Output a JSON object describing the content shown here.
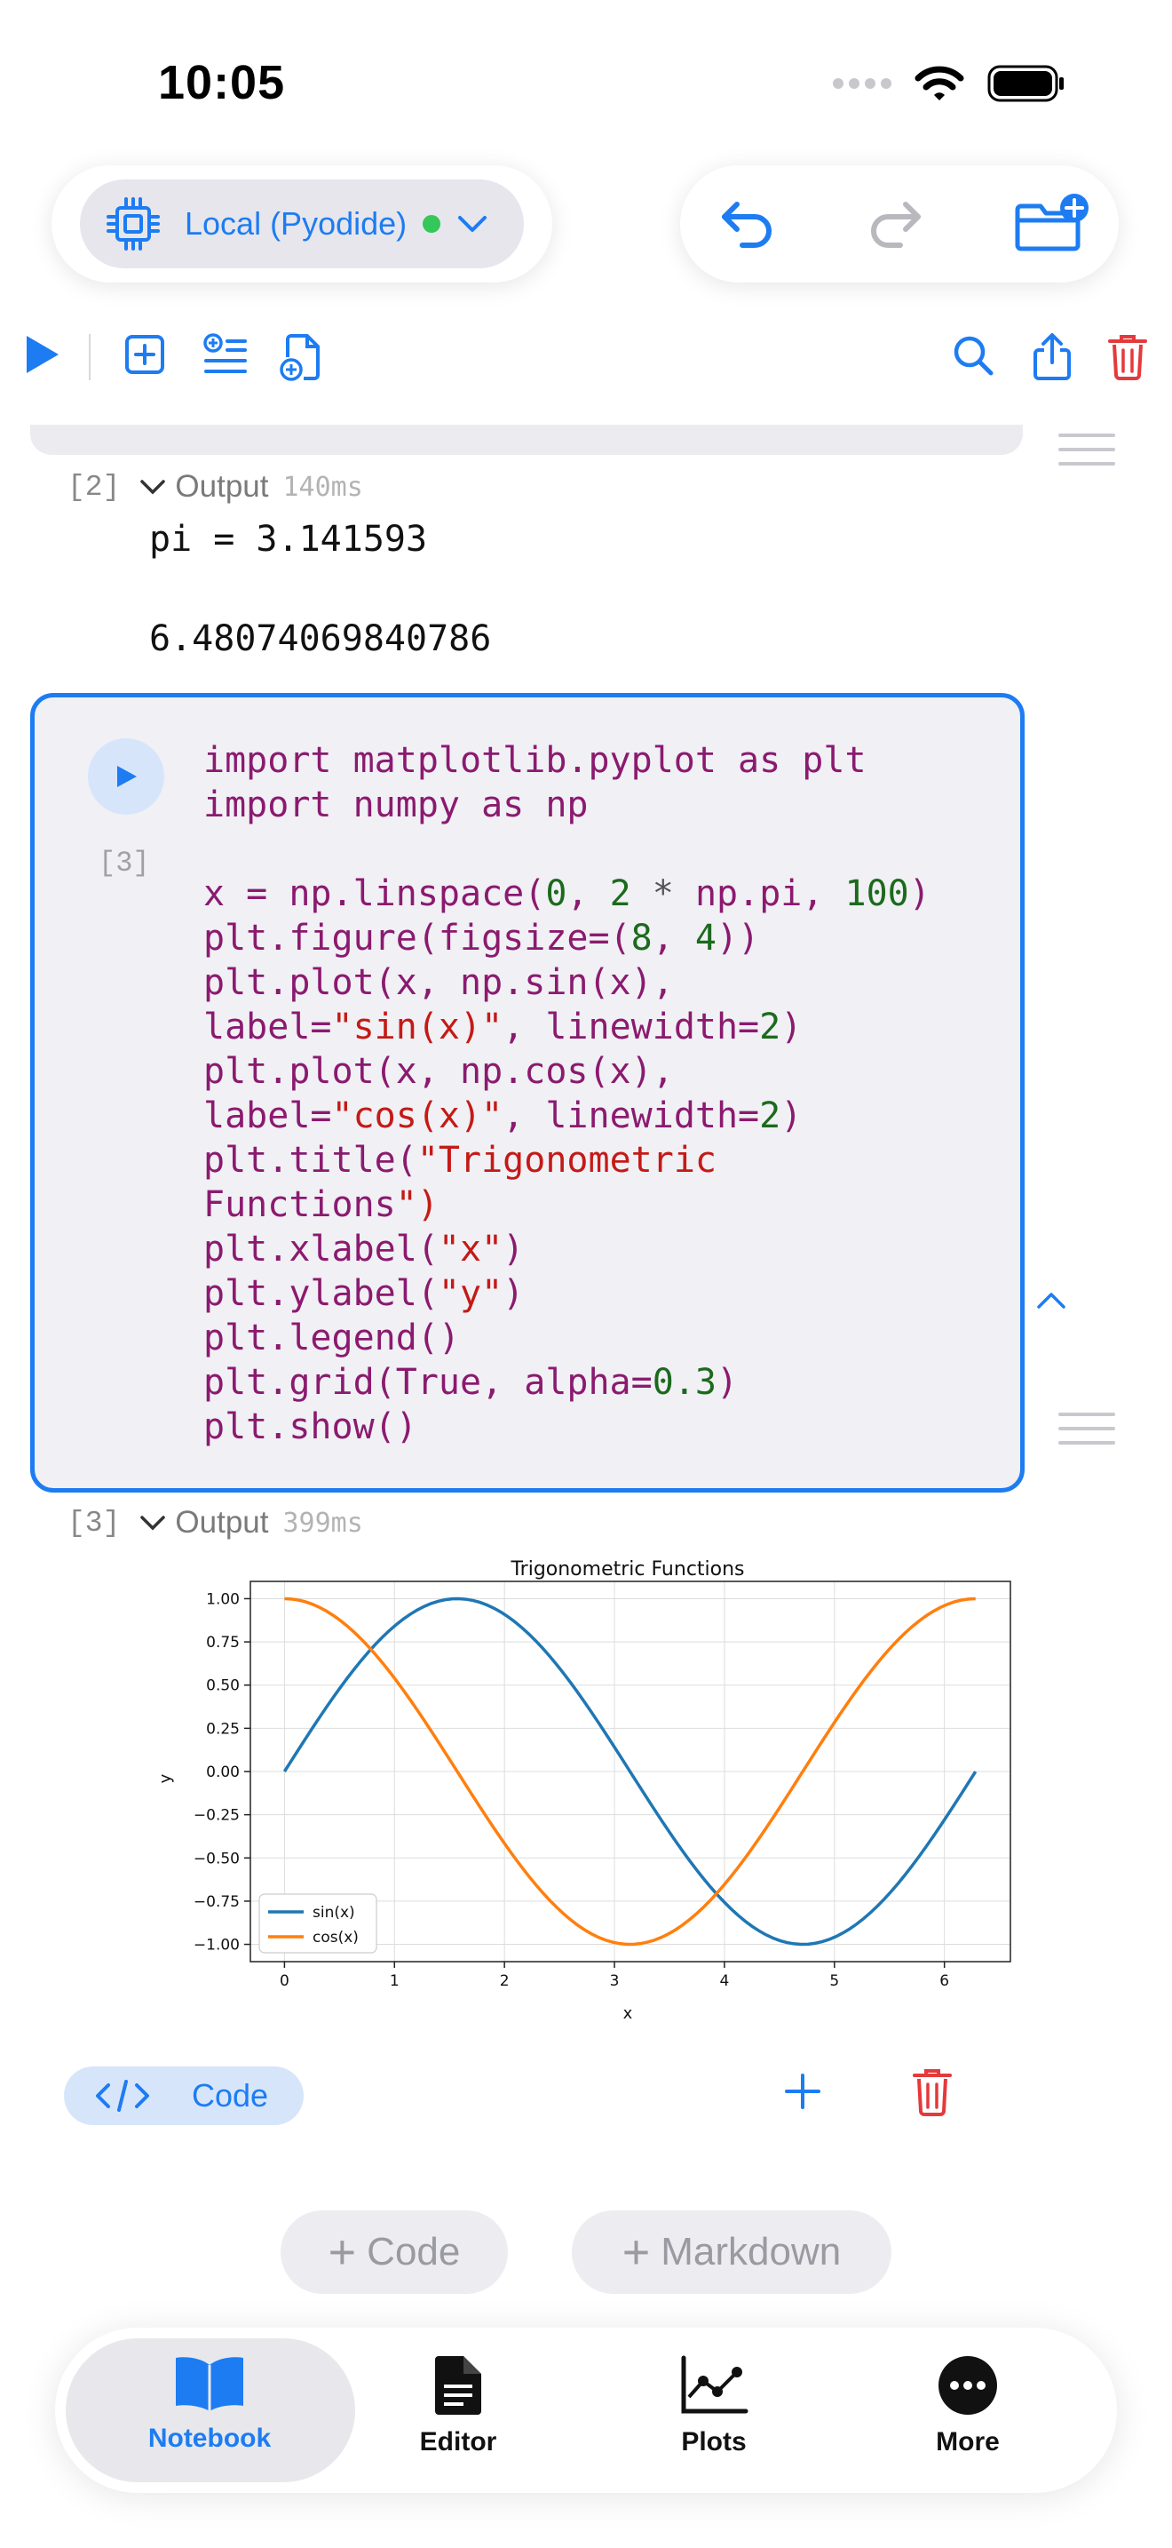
{
  "status_bar": {
    "time": "10:05"
  },
  "header": {
    "runtime_label": "Local (Pyodide)",
    "runtime_status_color": "#34c759",
    "icons": [
      "cpu-icon",
      "undo-icon",
      "redo-icon",
      "folder-add-icon"
    ]
  },
  "toolbar": {
    "left_icons": [
      "run-all-icon",
      "add-cell-icon",
      "insert-list-icon",
      "new-document-icon"
    ],
    "right_icons": [
      "search-icon",
      "share-icon",
      "trash-icon"
    ]
  },
  "output_2": {
    "number": "[2]",
    "label": "Output",
    "time": "140ms",
    "line1": "pi = 3.141593",
    "line2": "6.48074069840786"
  },
  "cell_3": {
    "number": "[3]",
    "code_lines": [
      "import matplotlib.pyplot as plt",
      "import numpy as np",
      "",
      "x = np.linspace(0, 2 * np.pi, 100)",
      "plt.figure(figsize=(8, 4))",
      "plt.plot(x, np.sin(x),",
      "label=\"sin(x)\", linewidth=2)",
      "plt.plot(x, np.cos(x),",
      "label=\"cos(x)\", linewidth=2)",
      "plt.title(\"Trigonometric",
      "Functions\")",
      "plt.xlabel(\"x\")",
      "plt.ylabel(\"y\")",
      "plt.legend()",
      "plt.grid(True, alpha=0.3)",
      "plt.show()"
    ]
  },
  "output_3": {
    "number": "[3]",
    "label": "Output",
    "time": "399ms"
  },
  "chart_data": {
    "type": "line",
    "title": "Trigonometric Functions",
    "xlabel": "x",
    "ylabel": "y",
    "xlim": [
      -0.31,
      6.6
    ],
    "ylim": [
      -1.1,
      1.1
    ],
    "xticks": [
      "0",
      "1",
      "2",
      "3",
      "4",
      "5",
      "6"
    ],
    "yticks": [
      "1.00",
      "0.75",
      "0.50",
      "0.25",
      "0.00",
      "−0.25",
      "−0.50",
      "−0.75",
      "−1.00"
    ],
    "grid": true,
    "legend_position": "lower-left",
    "series": [
      {
        "name": "sin(x)",
        "color": "#1f77b4",
        "function": "sin",
        "x_range": [
          0,
          6.283
        ],
        "points": 100
      },
      {
        "name": "cos(x)",
        "color": "#ff7f0e",
        "function": "cos",
        "x_range": [
          0,
          6.283
        ],
        "points": 100
      }
    ]
  },
  "cell_footer": {
    "type_label": "Code"
  },
  "add_buttons": {
    "code_label": "Code",
    "markdown_label": "Markdown"
  },
  "tabbar": {
    "tabs": [
      {
        "label": "Notebook",
        "icon": "book-icon",
        "active": true
      },
      {
        "label": "Editor",
        "icon": "document-icon",
        "active": false
      },
      {
        "label": "Plots",
        "icon": "chart-icon",
        "active": false
      },
      {
        "label": "More",
        "icon": "more-icon",
        "active": false
      }
    ]
  },
  "colors": {
    "accent": "#1d7cf2",
    "danger": "#e5393b"
  }
}
